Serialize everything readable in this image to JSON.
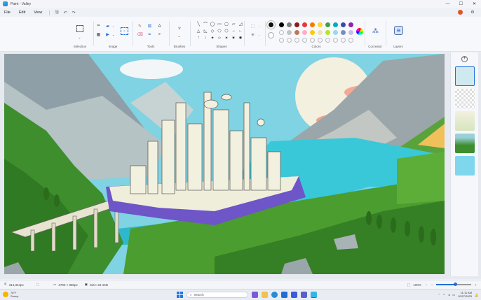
{
  "titlebar": {
    "title": "Paint - Valley",
    "controls": [
      "—",
      "☐",
      "✕"
    ]
  },
  "menu": {
    "items": [
      "File",
      "Edit",
      "View"
    ],
    "quick_actions": [
      "save-icon",
      "undo-icon",
      "redo-icon"
    ]
  },
  "ribbon": {
    "groups": {
      "selection": "Selection",
      "image": "Image",
      "tools": "Tools",
      "brushes": "Brushes",
      "shapes": "Shapes",
      "colors": "Colors",
      "cocreator": "Cocreator",
      "layers": "Layers"
    },
    "shape_glyphs": [
      "╲",
      "⌒",
      "◯",
      "▭",
      "▢",
      "▱",
      "◿",
      "△",
      "◺",
      "◇",
      "⬠",
      "⬡",
      "→",
      "←",
      "↑",
      "↓",
      "✦",
      "☆",
      "✶",
      "✷",
      "✸"
    ],
    "palette": [
      "#000000",
      "#7f7f7f",
      "#8b1a1a",
      "#e53935",
      "#f57c00",
      "#fdd835",
      "#43a047",
      "#00acc1",
      "#3949ab",
      "#8e24aa",
      "#ffffff",
      "#c3c3c3",
      "#b97a57",
      "#ffaec9",
      "#ffc90e",
      "#efe4b0",
      "#b5e61d",
      "#99d9ea",
      "#7092be",
      "#c8bfe7"
    ],
    "empty_swatches": 10,
    "current_color": "#000000"
  },
  "statusbar": {
    "cursor": "314,324px",
    "canvas_size": "3790 × 880px",
    "file_size": "Size: 20.4KB",
    "zoom": "100%",
    "zoom_fraction": 0.55
  },
  "taskbar": {
    "weather_temp": "78°F",
    "weather_desc": "Sunny",
    "search_placeholder": "Search",
    "time": "11:11 AM",
    "date": "10/27/2023"
  }
}
